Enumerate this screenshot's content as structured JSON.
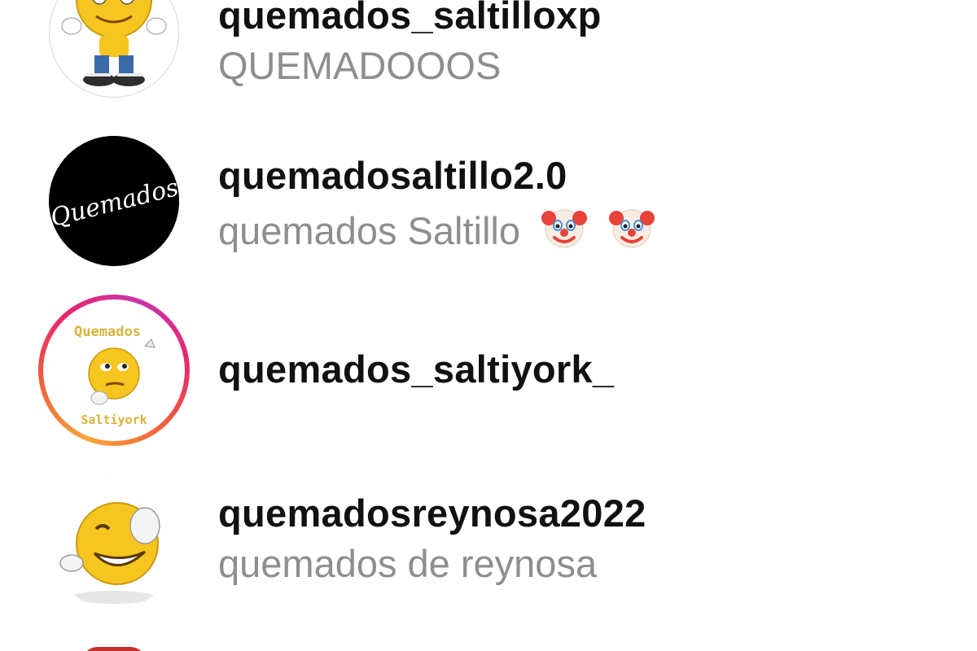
{
  "results": [
    {
      "username": "quemados_saltilloxp",
      "full_name": "QUEMADOOOS",
      "avatar": "emoji-cartoon-avatar",
      "has_story_ring": false
    },
    {
      "username": "quemadosaltillo2.0",
      "full_name": "quemados Saltillo",
      "full_name_emojis": [
        "clown-face-emoji",
        "clown-face-emoji"
      ],
      "avatar": "black-circle-logo-avatar",
      "avatar_text": "Quemados",
      "has_story_ring": false
    },
    {
      "username": "quemados_saltiyork_",
      "full_name": "",
      "avatar": "thinking-emoji-avatar",
      "avatar_text_top": "Quemados",
      "avatar_text_bottom": "Saltiyork",
      "has_story_ring": true
    },
    {
      "username": "quemadosreynosa2022",
      "full_name": "quemados de reynosa",
      "avatar": "laughing-emoji-avatar",
      "has_story_ring": false
    }
  ],
  "colors": {
    "username": "#111111",
    "full_name": "#8e8e8e",
    "story_ring": [
      "#f9a53a",
      "#e8246f",
      "#c837ab"
    ],
    "emoji_yellow": "#f7c520",
    "partial_avatar": "#c8302f"
  }
}
